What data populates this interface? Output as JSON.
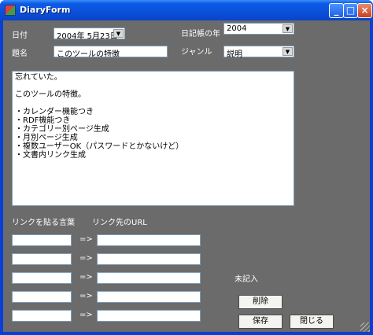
{
  "window": {
    "title": "DiaryForm"
  },
  "controls": {
    "minimize": "_",
    "maximize": "□",
    "close": "×"
  },
  "labels": {
    "date": "日付",
    "title": "題名",
    "diary_year": "日記帳の年",
    "genre": "ジャンル",
    "link_text_header": "リンクを貼る言葉",
    "link_url_header": "リンク先のURL",
    "arrow": "=>",
    "status": "未記入"
  },
  "fields": {
    "date_value": "2004年  5月23日",
    "year_value": "2004",
    "title_value": "このツールの特徴",
    "genre_value": "説明"
  },
  "body_lines": [
    "忘れていた。",
    "",
    "このツールの特徴。",
    "",
    "・カレンダー機能つき",
    "・RDF機能つき",
    "・カテゴリー別ページ生成",
    "・月別ページ生成",
    "・複数ユーザーOK（パスワードとかないけど）",
    "・文書内リンク生成"
  ],
  "links": [
    {
      "text": "",
      "url": ""
    },
    {
      "text": "",
      "url": ""
    },
    {
      "text": "",
      "url": ""
    },
    {
      "text": "",
      "url": ""
    },
    {
      "text": "",
      "url": ""
    }
  ],
  "buttons": {
    "delete": "削除",
    "save": "保存",
    "close": "閉じる"
  }
}
